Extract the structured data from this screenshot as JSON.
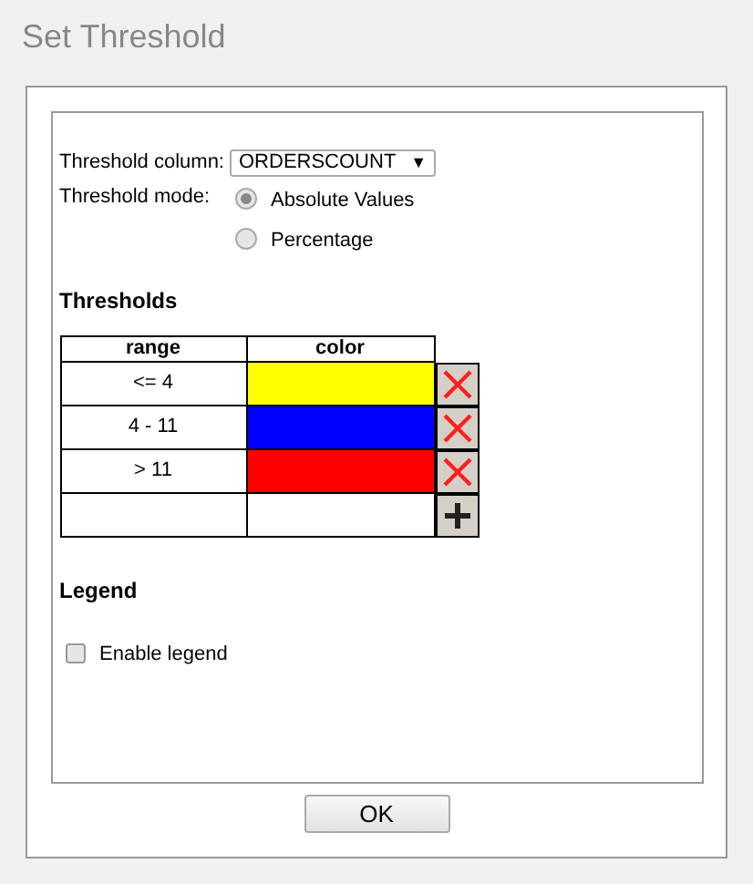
{
  "dialog": {
    "title": "Set Threshold"
  },
  "threshold_column": {
    "label": "Threshold column:",
    "value": "ORDERSCOUNT",
    "arrow": "▼"
  },
  "threshold_mode": {
    "label": "Threshold mode:",
    "options": [
      {
        "label": "Absolute Values",
        "selected": true
      },
      {
        "label": "Percentage",
        "selected": false
      }
    ]
  },
  "thresholds": {
    "heading": "Thresholds",
    "columns": [
      "range",
      "color"
    ],
    "rows": [
      {
        "range": "<= 4",
        "color": "#ffff00"
      },
      {
        "range": "4 - 11",
        "color": "#0000ff"
      },
      {
        "range": "> 11",
        "color": "#ff0000"
      }
    ]
  },
  "legend": {
    "heading": "Legend",
    "checkbox": {
      "label": "Enable legend",
      "checked": false
    }
  },
  "buttons": [
    "OK"
  ]
}
